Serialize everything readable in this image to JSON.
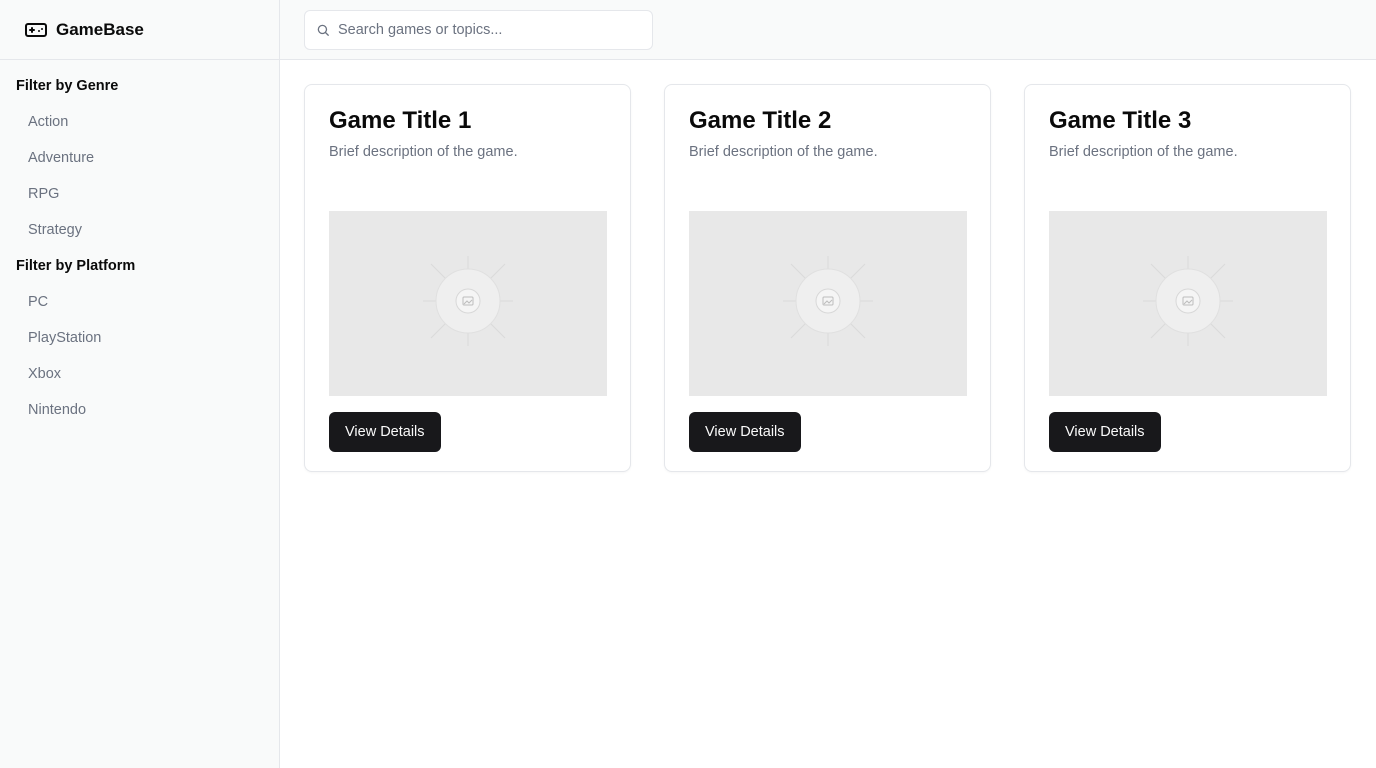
{
  "brand": {
    "name": "GameBase",
    "icon": "gamepad-icon"
  },
  "search": {
    "placeholder": "Search games or topics...",
    "value": "",
    "icon": "search-icon"
  },
  "filters": {
    "genre": {
      "heading": "Filter by Genre",
      "items": [
        "Action",
        "Adventure",
        "RPG",
        "Strategy"
      ]
    },
    "platform": {
      "heading": "Filter by Platform",
      "items": [
        "PC",
        "PlayStation",
        "Xbox",
        "Nintendo"
      ]
    }
  },
  "cards": [
    {
      "title": "Game Title 1",
      "description": "Brief description of the game.",
      "button_label": "View Details",
      "image_icon": "image-placeholder-icon"
    },
    {
      "title": "Game Title 2",
      "description": "Brief description of the game.",
      "button_label": "View Details",
      "image_icon": "image-placeholder-icon"
    },
    {
      "title": "Game Title 3",
      "description": "Brief description of the game.",
      "button_label": "View Details",
      "image_icon": "image-placeholder-icon"
    }
  ],
  "colors": {
    "sidebar_bg": "#f9fafa",
    "border": "#e5e7eb",
    "muted_text": "#6b7280",
    "button_bg": "#18181b",
    "button_text": "#fafafa",
    "image_placeholder": "#e8e8e8"
  }
}
